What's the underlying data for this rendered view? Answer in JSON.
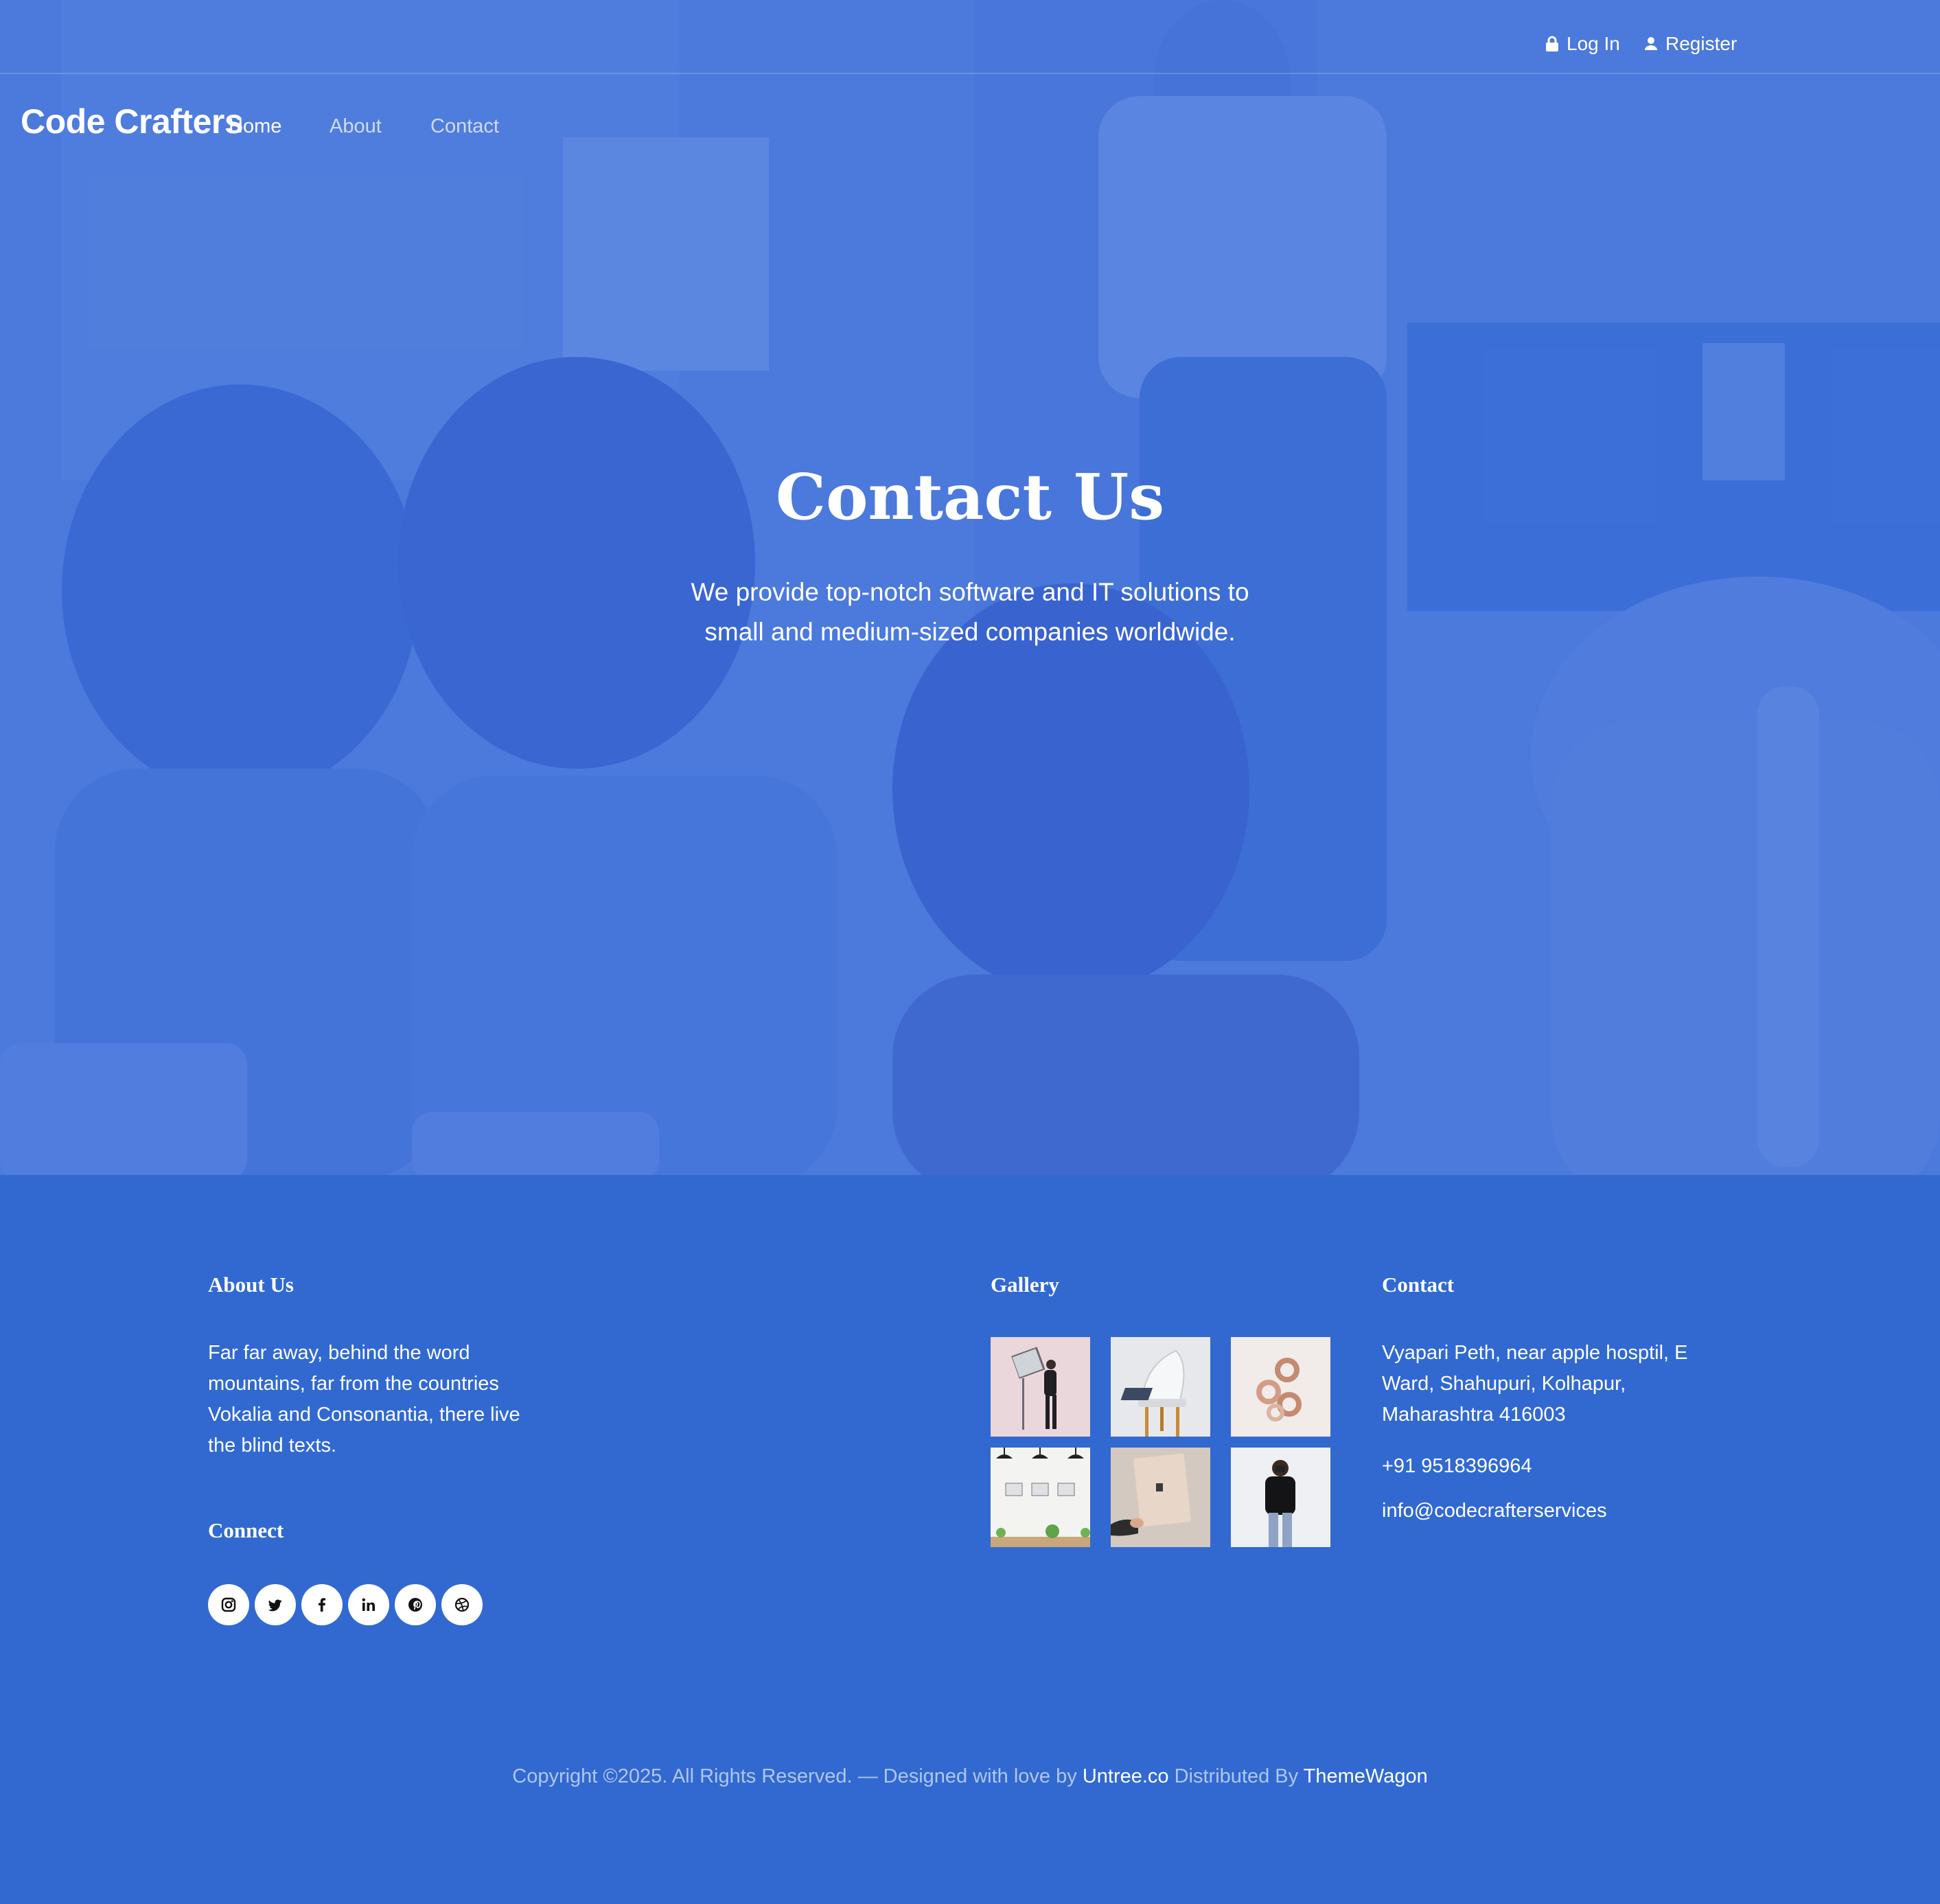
{
  "topbar": {
    "login_label": "Log In",
    "register_label": "Register",
    "login_icon": "lock-icon",
    "register_icon": "user-icon"
  },
  "nav": {
    "brand": "Code Crafters",
    "items": [
      {
        "label": "Home",
        "active": true
      },
      {
        "label": "About",
        "active": false
      },
      {
        "label": "Contact",
        "active": false
      }
    ]
  },
  "hero": {
    "title": "Contact Us",
    "subtitle": "We provide top-notch software and IT solutions to small and medium-sized companies worldwide."
  },
  "footer": {
    "about": {
      "heading": "About Us",
      "text": "Far far away, behind the word mountains, far from the countries Vokalia and Consonantia, there live the blind texts."
    },
    "connect": {
      "heading": "Connect",
      "icons": [
        "instagram-icon",
        "twitter-icon",
        "facebook-icon",
        "linkedin-icon",
        "pinterest-icon",
        "dribbble-icon"
      ]
    },
    "gallery": {
      "heading": "Gallery",
      "images": [
        "gallery-image-1",
        "gallery-image-2",
        "gallery-image-3",
        "gallery-image-4",
        "gallery-image-5",
        "gallery-image-6"
      ]
    },
    "contact": {
      "heading": "Contact",
      "address": "Vyapari Peth, near apple hosptil, E Ward, Shahupuri, Kolhapur, Maharashtra 416003",
      "phone": "+91 9518396964",
      "email": "info@codecrafterservices"
    },
    "copyright": {
      "prefix": "Copyright ©2025. All Rights Reserved. — Designed with love by ",
      "link1": "Untree.co",
      "middle": " Distributed By ",
      "link2": "ThemeWagon"
    }
  },
  "colors": {
    "primary": "#3169d1",
    "hero_overlay": "#4d7ad8",
    "text": "#ffffff"
  }
}
